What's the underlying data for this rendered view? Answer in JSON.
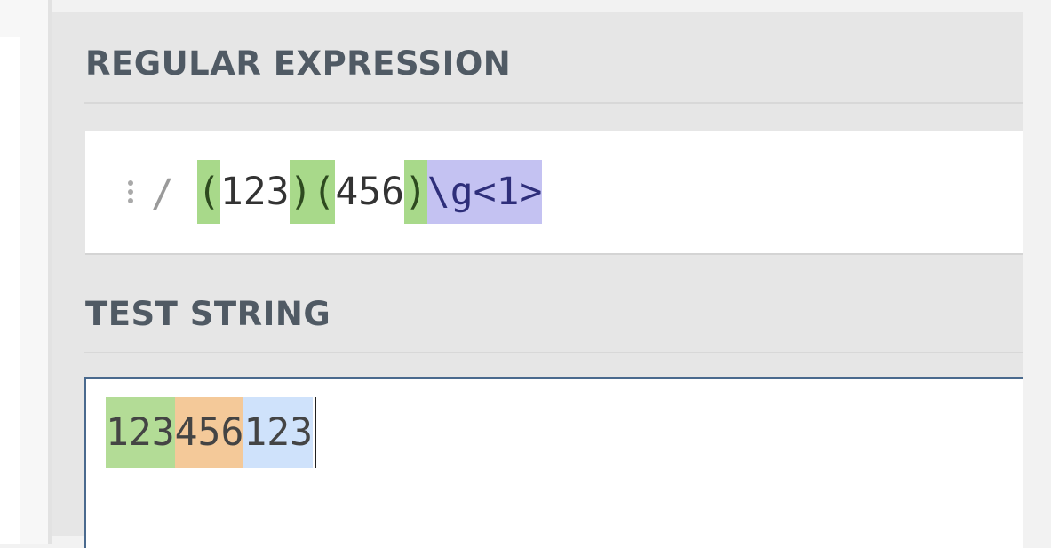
{
  "regex_section": {
    "title": "REGULAR EXPRESSION",
    "delimiter": "/",
    "tokens": [
      {
        "text": "(",
        "kind": "group-paren"
      },
      {
        "text": "123",
        "kind": "literal"
      },
      {
        "text": ")",
        "kind": "group-paren"
      },
      {
        "text": "(",
        "kind": "group-paren"
      },
      {
        "text": "456",
        "kind": "literal"
      },
      {
        "text": ")",
        "kind": "group-paren"
      },
      {
        "text": "\\g<1>",
        "kind": "backreference"
      }
    ]
  },
  "test_section": {
    "title": "TEST STRING",
    "segments": [
      {
        "text": "123",
        "kind": "group-1-match"
      },
      {
        "text": "456",
        "kind": "group-2-match"
      },
      {
        "text": "123",
        "kind": "backreference-match"
      }
    ]
  },
  "icons": {
    "flag_menu": "vertical-dots-icon"
  },
  "colors": {
    "group_paren": "#a8d98a",
    "backreference": "#c4c2f2",
    "match_group_1": "#b3dc96",
    "match_group_2": "#f4c999",
    "match_backreference": "#cfe2fb",
    "focus_border": "#4a6a8e"
  }
}
